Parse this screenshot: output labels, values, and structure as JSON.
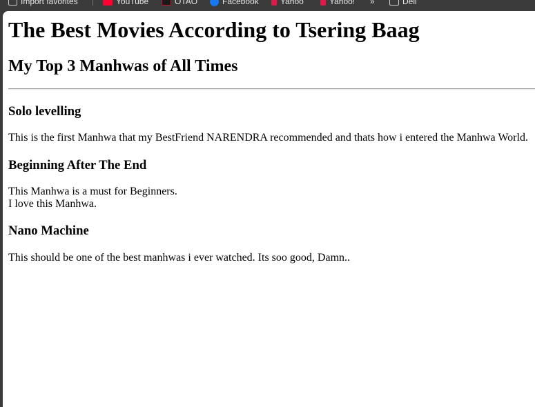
{
  "bookmarks": [
    {
      "label": "Import favorites",
      "icon": "import-icon",
      "color": "#cfcfcf"
    },
    {
      "label": "YouTube",
      "icon": "youtube-icon",
      "color": "#ff0033"
    },
    {
      "label": "OTAO",
      "icon": "site-icon",
      "color": "#c8102e"
    },
    {
      "label": "Facebook",
      "icon": "facebook-icon",
      "color": "#1877f2"
    },
    {
      "label": "Yahoo",
      "icon": "yahoo-icon",
      "color": "#e0194a"
    },
    {
      "label": "Yahoo!",
      "icon": "yahoo-icon",
      "color": "#e0194a"
    },
    {
      "label": "Dell",
      "icon": "folder-icon",
      "color": "#cfcfcf"
    }
  ],
  "page": {
    "title": "The Best Movies According to Tsering Baag",
    "subtitle": "My Top 3 Manhwas of All Times",
    "items": [
      {
        "heading": "Solo levelling",
        "lines": [
          "This is the first Manhwa that my BestFriend NARENDRA recommended and thats how i entered the Manhwa World."
        ]
      },
      {
        "heading": "Beginning After The End",
        "lines": [
          "This Manhwa is a must for Beginners.",
          "I love this Manhwa."
        ]
      },
      {
        "heading": "Nano Machine",
        "lines": [
          "This should be one of the best manhwas i ever watched. Its soo good, Damn.."
        ]
      }
    ]
  }
}
